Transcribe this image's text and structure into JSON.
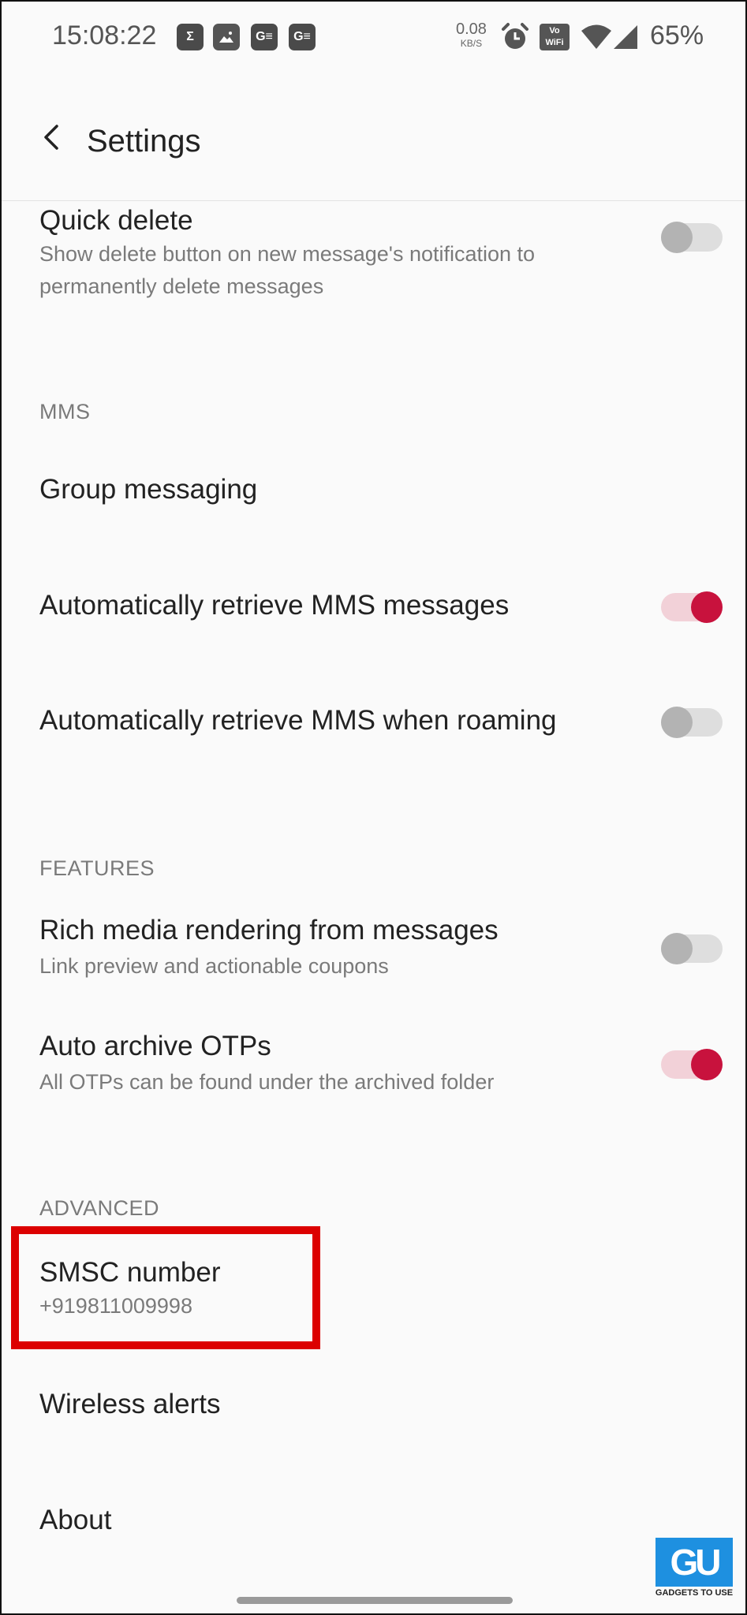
{
  "status_bar": {
    "time": "15:08:22",
    "notification_icons": [
      "sigma-icon",
      "gallery-icon",
      "news-icon",
      "news-icon"
    ],
    "net_speed_value": "0.08",
    "net_speed_unit": "KB/S",
    "volte_label": "Vo WiFi",
    "battery": "65%"
  },
  "app_bar": {
    "title": "Settings"
  },
  "settings": {
    "quick_delete": {
      "title": "Quick delete",
      "subtitle": "Show delete button on new message's notification to permanently delete messages",
      "enabled": false
    },
    "mms_header": "MMS",
    "group_messaging": {
      "title": "Group messaging"
    },
    "auto_retrieve_mms": {
      "title": "Automatically retrieve MMS messages",
      "enabled": true
    },
    "auto_retrieve_roaming": {
      "title": "Automatically retrieve MMS when roaming",
      "enabled": false
    },
    "features_header": "FEATURES",
    "rich_media": {
      "title": "Rich media rendering from messages",
      "subtitle": "Link preview and actionable coupons",
      "enabled": false
    },
    "auto_archive": {
      "title": "Auto archive OTPs",
      "subtitle": "All OTPs can be found under the archived folder",
      "enabled": true
    },
    "advanced_header": "ADVANCED",
    "smsc": {
      "title": "SMSC number",
      "value": "+919811009998"
    },
    "wireless_alerts": {
      "title": "Wireless alerts"
    },
    "about": {
      "title": "About"
    }
  },
  "watermark": {
    "logo": "GU",
    "text": "GADGETS TO USE"
  },
  "colors": {
    "accent": "#c8123d",
    "highlight": "#dc0000",
    "background": "#fafafa"
  }
}
